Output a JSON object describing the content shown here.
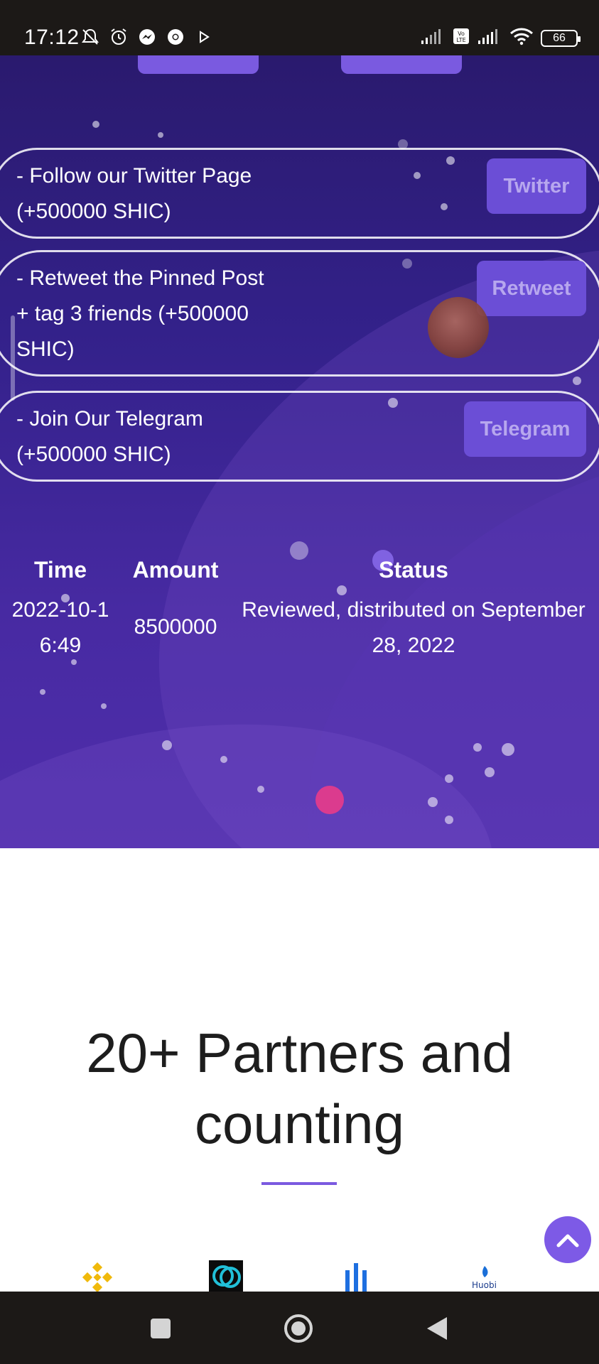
{
  "status_bar": {
    "time": "17:12",
    "battery": "66",
    "icons": [
      "mute-icon",
      "alarm-icon",
      "messenger-icon",
      "chrome-icon",
      "play-icon",
      "signal-icon",
      "volte-icon",
      "wifi-icon",
      "battery-icon"
    ]
  },
  "tasks": [
    {
      "text": "- Follow our Twitter Page\n(+500000 SHIC)",
      "button": "Twitter"
    },
    {
      "text": "- Retweet the Pinned Post\n+ tag 3 friends (+500000\nSHIC)",
      "button": "Retweet"
    },
    {
      "text": "- Join Our Telegram\n(+500000 SHIC)",
      "button": "Telegram"
    }
  ],
  "table": {
    "headers": {
      "time": "Time",
      "amount": "Amount",
      "status": "Status"
    },
    "rows": [
      {
        "time": "2022-10-1\n6:49",
        "amount": "8500000",
        "status": "Reviewed, distributed on September\n28, 2022"
      }
    ]
  },
  "partners": {
    "title": "20+ Partners and\ncounting",
    "logos": [
      "binance-logo",
      "gemini-logo",
      "coinmarketcap-logo",
      "huobi-logo"
    ],
    "huobi_label": "Huobi"
  },
  "colors": {
    "accent": "#7b5ae0",
    "button_bg": "#6b4ed6",
    "button_text": "#b7a7ee",
    "status_bar": "#1c1917"
  }
}
